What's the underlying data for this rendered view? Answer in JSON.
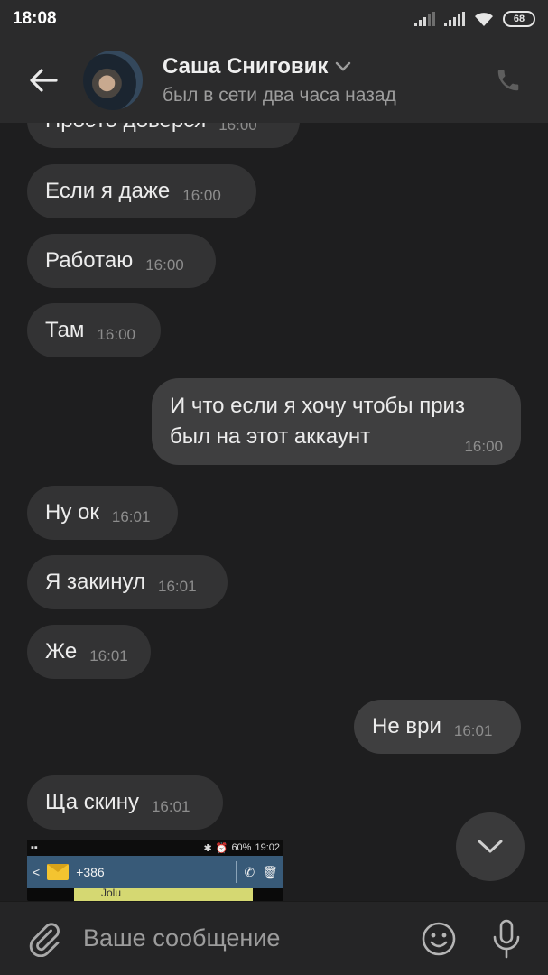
{
  "status_bar": {
    "time": "18:08",
    "battery": "68"
  },
  "header": {
    "contact_name": "Саша Сниговик",
    "contact_status": "был в сети два часа назад"
  },
  "messages": [
    {
      "direction": "in",
      "text": "Просто доверся",
      "time": "16:00"
    },
    {
      "direction": "in",
      "text": "Если я даже",
      "time": "16:00"
    },
    {
      "direction": "in",
      "text": "Работаю",
      "time": "16:00"
    },
    {
      "direction": "in",
      "text": "Там",
      "time": "16:00"
    },
    {
      "direction": "out",
      "text_line1": "И что если я хочу чтобы приз",
      "text_line2": "был на этот аккаунт",
      "time": "16:00"
    },
    {
      "direction": "in",
      "text": "Ну ок",
      "time": "16:01"
    },
    {
      "direction": "in",
      "text": "Я закинул",
      "time": "16:01"
    },
    {
      "direction": "in",
      "text": "Же",
      "time": "16:01"
    },
    {
      "direction": "out",
      "text": "Не ври",
      "time": "16:01"
    },
    {
      "direction": "in",
      "text": "Ща скину",
      "time": "16:01"
    }
  ],
  "attachment_preview": {
    "status_battery": "60%",
    "status_time": "19:02",
    "phone_number": "+386",
    "partial_text": "Jolu"
  },
  "composer": {
    "placeholder": "Ваше сообщение"
  },
  "colors": {
    "background": "#1e1e1f",
    "header": "#2b2b2c",
    "incoming_bubble": "#333334",
    "outgoing_bubble": "#3f3f40",
    "timestamp": "#8d8d8d"
  },
  "icons": {
    "back": "arrow-left-icon",
    "call": "phone-icon",
    "dropdown": "chevron-down-icon",
    "attach": "paperclip-icon",
    "emoji": "smiley-icon",
    "mic": "microphone-icon",
    "scroll_down": "chevron-down-icon"
  }
}
